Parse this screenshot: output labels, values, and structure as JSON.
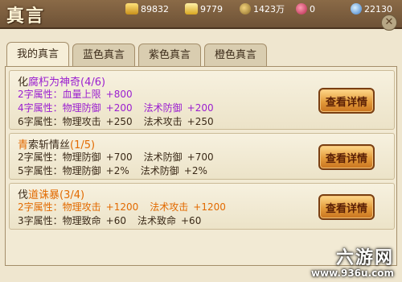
{
  "header": {
    "title": "真言",
    "resources": [
      {
        "icon": "gold-pot-icon",
        "value": "89832"
      },
      {
        "icon": "gold-ingot-icon",
        "value": "9779"
      },
      {
        "icon": "coin-icon",
        "value": "1423万"
      },
      {
        "icon": "badge-icon",
        "value": "0"
      },
      {
        "icon": "spirit-orb-icon",
        "value": "22130"
      }
    ]
  },
  "tabs": [
    {
      "label": "我的真言",
      "active": true
    },
    {
      "label": "蓝色真言",
      "active": false
    },
    {
      "label": "紫色真言",
      "active": false
    },
    {
      "label": "橙色真言",
      "active": false
    }
  ],
  "cards": [
    {
      "name_prefix": "化",
      "name_main": "腐朽为神奇",
      "name_count": "(4/6)",
      "lines": [
        {
          "key": "2字属性：",
          "a": "血量上限",
          "av": "+800",
          "b": "",
          "bv": ""
        },
        {
          "key": "4字属性：",
          "a": "物理防御",
          "av": "+200",
          "b": "法术防御",
          "bv": "+200"
        },
        {
          "key": "6字属性：",
          "a": "物理攻击",
          "av": "+250",
          "b": "法术攻击",
          "bv": "+250"
        }
      ],
      "button": "查看详情"
    },
    {
      "name_prefix": "青",
      "name_main": "索斩情丝",
      "name_count": "(1/5)",
      "lines": [
        {
          "key": "2字属性：",
          "a": "物理防御",
          "av": "+700",
          "b": "法术防御",
          "bv": "+700"
        },
        {
          "key": "5字属性：",
          "a": "物理防御",
          "av": "+2%",
          "b": "法术防御",
          "bv": "+2%"
        }
      ],
      "button": "查看详情"
    },
    {
      "name_prefix": "伐",
      "name_main": "道诛暴",
      "name_count": "(3/4)",
      "lines": [
        {
          "key": "2字属性：",
          "a": "物理攻击",
          "av": "+1200",
          "b": "法术攻击",
          "bv": "+1200"
        },
        {
          "key": "3字属性：",
          "a": "物理致命",
          "av": "+60",
          "b": "法术致命",
          "bv": "+60"
        }
      ],
      "button": "查看详情"
    }
  ],
  "watermark": {
    "line1": "六游网",
    "line2": "www.936u.com"
  },
  "colors": {
    "purple": "#9b1fd0",
    "orange": "#e26a00",
    "button": "#e39b3a"
  }
}
